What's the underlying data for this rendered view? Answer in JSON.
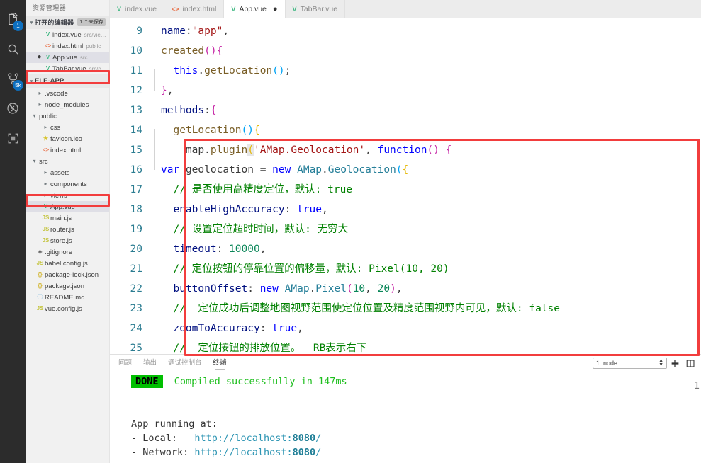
{
  "activitybar": {
    "items": [
      {
        "name": "explorer",
        "icon": "files-icon",
        "badge": "1"
      },
      {
        "name": "search",
        "icon": "search-icon",
        "badge": ""
      },
      {
        "name": "source-control",
        "icon": "source-control-icon",
        "badge": "5k"
      },
      {
        "name": "run-debug",
        "icon": "run-debug-disabled-icon",
        "badge": ""
      },
      {
        "name": "extensions",
        "icon": "extensions-icon",
        "badge": ""
      }
    ]
  },
  "sidebar": {
    "title": "资源管理器",
    "open_editors": {
      "label": "打开的编辑器",
      "badge": "1 个未保存",
      "items": [
        {
          "icon": "vue-icon",
          "name": "index.vue",
          "path": "src/vie…",
          "dirty": false,
          "selected": false
        },
        {
          "icon": "html-icon",
          "name": "index.html",
          "path": "public",
          "dirty": false,
          "selected": false
        },
        {
          "icon": "vue-icon",
          "name": "App.vue",
          "path": "src",
          "dirty": true,
          "selected": true
        },
        {
          "icon": "vue-icon",
          "name": "TabBar.vue",
          "path": "src/c…",
          "dirty": false,
          "selected": false
        }
      ]
    },
    "project": {
      "label": "ELE-APP",
      "items": [
        {
          "icon": "folder-icon",
          "name": ".vscode",
          "indent": 1,
          "expandable": true,
          "expanded": false
        },
        {
          "icon": "folder-icon",
          "name": "node_modules",
          "indent": 1,
          "expandable": true,
          "expanded": false
        },
        {
          "icon": "folder-icon",
          "name": "public",
          "indent": 1,
          "expandable": true,
          "expanded": true
        },
        {
          "icon": "folder-icon",
          "name": "css",
          "indent": 2,
          "expandable": true,
          "expanded": false
        },
        {
          "icon": "star-icon",
          "name": "favicon.ico",
          "indent": 2,
          "expandable": false,
          "expanded": false
        },
        {
          "icon": "html-icon",
          "name": "index.html",
          "indent": 2,
          "expandable": false,
          "expanded": false
        },
        {
          "icon": "folder-icon",
          "name": "src",
          "indent": 1,
          "expandable": true,
          "expanded": true
        },
        {
          "icon": "folder-icon",
          "name": "assets",
          "indent": 2,
          "expandable": true,
          "expanded": false
        },
        {
          "icon": "folder-icon",
          "name": "components",
          "indent": 2,
          "expandable": true,
          "expanded": false
        },
        {
          "icon": "folder-icon",
          "name": "views",
          "indent": 2,
          "expandable": true,
          "expanded": false
        },
        {
          "icon": "vue-icon",
          "name": "App.vue",
          "indent": 2,
          "expandable": false,
          "expanded": false,
          "selected": true
        },
        {
          "icon": "js-icon",
          "name": "main.js",
          "indent": 2,
          "expandable": false,
          "expanded": false
        },
        {
          "icon": "js-icon",
          "name": "router.js",
          "indent": 2,
          "expandable": false,
          "expanded": false
        },
        {
          "icon": "js-icon",
          "name": "store.js",
          "indent": 2,
          "expandable": false,
          "expanded": false
        },
        {
          "icon": "git-icon",
          "name": ".gitignore",
          "indent": 1,
          "expandable": false,
          "expanded": false
        },
        {
          "icon": "js-icon",
          "name": "babel.config.js",
          "indent": 1,
          "expandable": false,
          "expanded": false
        },
        {
          "icon": "json-icon",
          "name": "package-lock.json",
          "indent": 1,
          "expandable": false,
          "expanded": false
        },
        {
          "icon": "json-icon",
          "name": "package.json",
          "indent": 1,
          "expandable": false,
          "expanded": false
        },
        {
          "icon": "md-icon",
          "name": "README.md",
          "indent": 1,
          "expandable": false,
          "expanded": false
        },
        {
          "icon": "js-icon",
          "name": "vue.config.js",
          "indent": 1,
          "expandable": false,
          "expanded": false
        }
      ]
    }
  },
  "tabs": [
    {
      "icon": "vue-icon",
      "label": "index.vue",
      "active": false,
      "dirty": false
    },
    {
      "icon": "html-icon",
      "label": "index.html",
      "active": false,
      "dirty": false
    },
    {
      "icon": "vue-icon",
      "label": "App.vue",
      "active": true,
      "dirty": true
    },
    {
      "icon": "vue-icon",
      "label": "TabBar.vue",
      "active": false,
      "dirty": false
    }
  ],
  "editor": {
    "first_line_number": 9,
    "lines": [
      {
        "n": "9",
        "text": "  name:\"app\","
      },
      {
        "n": "10",
        "text": "  created(){"
      },
      {
        "n": "11",
        "text": "    this.getLocation();"
      },
      {
        "n": "12",
        "text": "  },"
      },
      {
        "n": "13",
        "text": "  methods:{"
      },
      {
        "n": "14",
        "text": "    getLocation(){"
      },
      {
        "n": "15",
        "text": "      map.plugin('AMap.Geolocation', function() {"
      },
      {
        "n": "16",
        "text": "var geolocation = new AMap.Geolocation({"
      },
      {
        "n": "17",
        "text": "  // 是否使用高精度定位，默认: true"
      },
      {
        "n": "18",
        "text": "  enableHighAccuracy: true,"
      },
      {
        "n": "19",
        "text": "  // 设置定位超时时间，默认: 无穷大"
      },
      {
        "n": "20",
        "text": "  timeout: 10000,"
      },
      {
        "n": "21",
        "text": "  // 定位按钮的停靠位置的偏移量，默认: Pixel(10, 20)"
      },
      {
        "n": "22",
        "text": "  buttonOffset: new AMap.Pixel(10, 20),"
      },
      {
        "n": "23",
        "text": "  //  定位成功后调整地图视野范围使定位位置及精度范围视野内可见，默认: false"
      },
      {
        "n": "24",
        "text": "  zoomToAccuracy: true,"
      },
      {
        "n": "25",
        "text": "  //  定位按钮的排放位置。  RB表示右下"
      }
    ]
  },
  "panel": {
    "tabs": [
      {
        "label": "问题",
        "active": false
      },
      {
        "label": "输出",
        "active": false
      },
      {
        "label": "调试控制台",
        "active": false
      },
      {
        "label": "终端",
        "active": true
      }
    ],
    "terminal_select": "1: node",
    "add_button": "+",
    "split_button": "⧉",
    "terminal": {
      "status_badge": "DONE",
      "status_message": "Compiled successfully in 147ms",
      "running_label": "App running at:",
      "local_label": "- Local:  ",
      "local_url_prefix": "http://localhost:",
      "local_port": "8080",
      "local_url_suffix": "/",
      "network_label": "- Network:",
      "network_url_prefix": "http://localhost:",
      "network_port": "8080",
      "network_url_suffix": "/",
      "right_marker": "1"
    }
  },
  "colors": {
    "accent_red": "#f23d3d",
    "vue_green": "#41b883",
    "badge_blue": "#0e70c0",
    "done_green": "#00bf00",
    "terminal_green": "#1fbf1f",
    "terminal_cyan": "#2f96b4"
  }
}
